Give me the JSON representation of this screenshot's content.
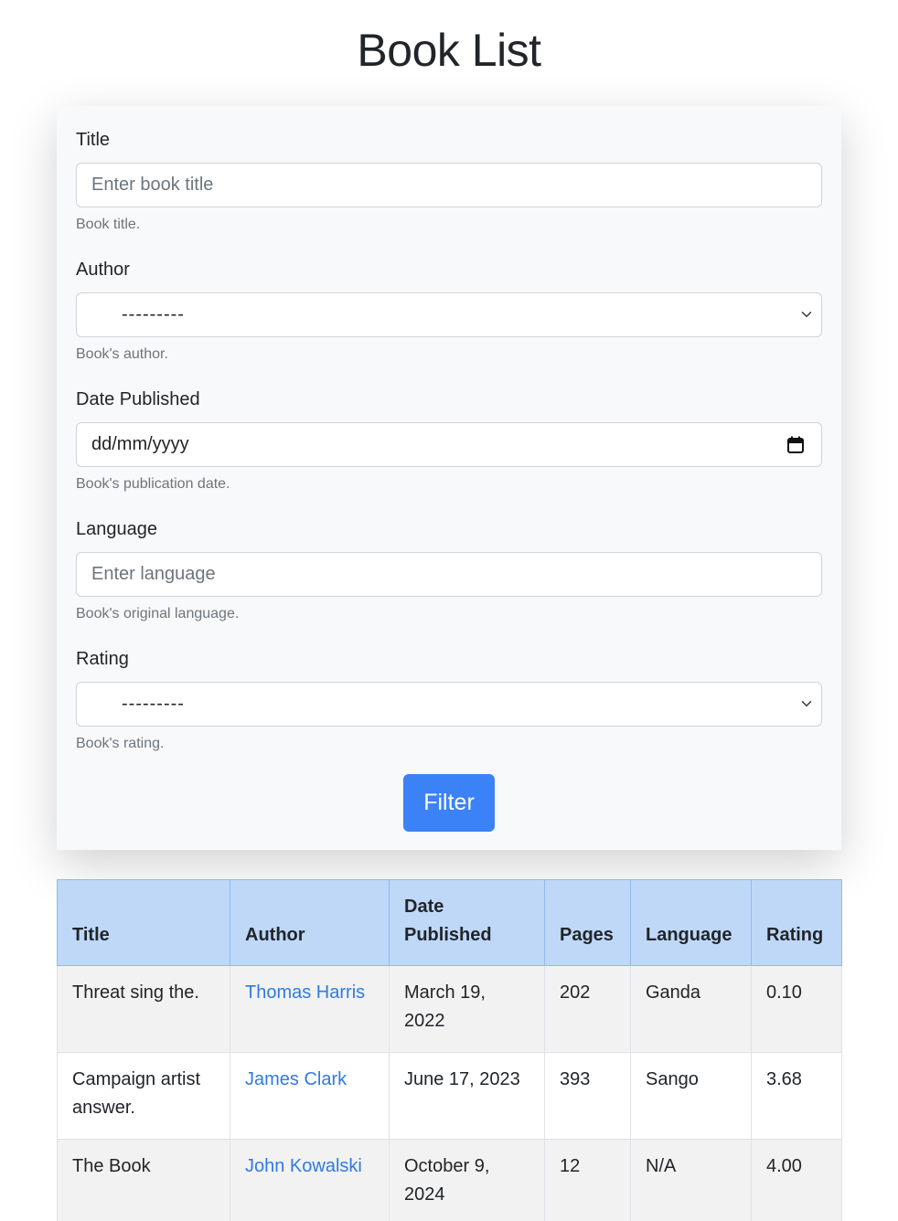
{
  "page": {
    "title": "Book List"
  },
  "form": {
    "fields": [
      {
        "label": "Title",
        "type": "text",
        "placeholder": "Enter book title",
        "value": "",
        "help": "Book title."
      },
      {
        "label": "Author",
        "type": "select",
        "value": "---------",
        "help": "Book's author."
      },
      {
        "label": "Date Published",
        "type": "date",
        "placeholder": "dd/mm/yyyy",
        "value": "",
        "help": "Book's publication date."
      },
      {
        "label": "Language",
        "type": "text",
        "placeholder": "Enter language",
        "value": "",
        "help": "Book's original language."
      },
      {
        "label": "Rating",
        "type": "select",
        "value": "---------",
        "help": "Book's rating."
      }
    ],
    "submit_label": "Filter"
  },
  "table": {
    "headers": [
      "Title",
      "Author",
      "Date Published",
      "Pages",
      "Language",
      "Rating"
    ],
    "rows": [
      {
        "title": "Threat sing the.",
        "author": "Thomas Harris",
        "date": "March 19, 2022",
        "pages": "202",
        "language": "Ganda",
        "rating": "0.10"
      },
      {
        "title": "Campaign artist answer.",
        "author": "James Clark",
        "date": "June 17, 2023",
        "pages": "393",
        "language": "Sango",
        "rating": "3.68"
      },
      {
        "title": "The Book",
        "author": "John Kowalski",
        "date": "October 9, 2024",
        "pages": "12",
        "language": "N/A",
        "rating": "4.00"
      }
    ]
  },
  "colors": {
    "primary": "#3b82f6",
    "link": "#2f7ae5",
    "header_bg": "#bfd8f8",
    "card_bg": "#f8f9fa",
    "stripe_bg": "#f2f2f2"
  },
  "icons": {
    "select": "chevron-down-icon",
    "date": "calendar-icon"
  }
}
